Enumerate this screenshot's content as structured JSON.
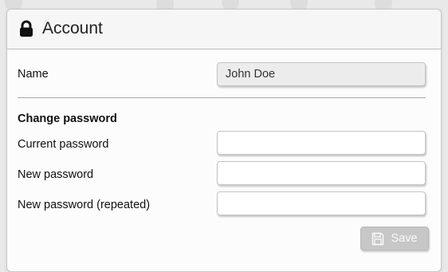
{
  "header": {
    "title": "Account",
    "icon": "lock-icon"
  },
  "profile": {
    "name_label": "Name",
    "name_value": "John Doe"
  },
  "password_section": {
    "title": "Change password",
    "current_label": "Current password",
    "current_value": "",
    "new_label": "New password",
    "new_value": "",
    "repeat_label": "New password (repeated)",
    "repeat_value": ""
  },
  "actions": {
    "save_label": "Save",
    "save_icon": "floppy-disk-icon",
    "save_disabled": true
  },
  "colors": {
    "page_background": "#e9e9e9",
    "panel_background": "#fcfcfc",
    "disabled_button": "#c7c7c7"
  }
}
